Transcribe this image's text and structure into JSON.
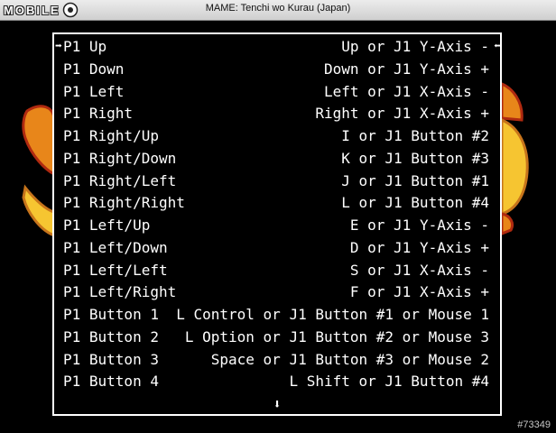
{
  "window": {
    "title": "MAME: Tenchi wo Kurau (Japan)"
  },
  "logo": {
    "text": "MOBILE",
    "icon": "eye-logo-icon"
  },
  "menu": {
    "rows": [
      {
        "name": "P1 Up",
        "value": "Up or J1 Y-Axis -"
      },
      {
        "name": "P1 Down",
        "value": "Down or J1 Y-Axis +"
      },
      {
        "name": "P1 Left",
        "value": "Left or J1 X-Axis -"
      },
      {
        "name": "P1 Right",
        "value": "Right or J1 X-Axis +"
      },
      {
        "name": "P1 Right/Up",
        "value": "I or J1 Button #2"
      },
      {
        "name": "P1 Right/Down",
        "value": "K or J1 Button #3"
      },
      {
        "name": "P1 Right/Left",
        "value": "J or J1 Button #1"
      },
      {
        "name": "P1 Right/Right",
        "value": "L or J1 Button #4"
      },
      {
        "name": "P1 Left/Up",
        "value": "E or J1 Y-Axis -"
      },
      {
        "name": "P1 Left/Down",
        "value": "D or J1 Y-Axis +"
      },
      {
        "name": "P1 Left/Left",
        "value": "S or J1 X-Axis -"
      },
      {
        "name": "P1 Left/Right",
        "value": "F or J1 X-Axis +"
      },
      {
        "name": "P1 Button 1",
        "value": "L Control or J1 Button #1 or Mouse 1"
      },
      {
        "name": "P1 Button 2",
        "value": "L Option or J1 Button #2 or Mouse 3"
      },
      {
        "name": "P1 Button 3",
        "value": "Space or J1 Button #3 or Mouse 2"
      },
      {
        "name": "P1 Button 4",
        "value": "L Shift or J1 Button #4"
      }
    ],
    "selected_index": 0,
    "selection_left_arrow": "➡",
    "selection_right_arrow": "⬅",
    "scroll_down_arrow": "⬇"
  },
  "colors": {
    "text": "#ffffff",
    "background": "#000000",
    "art_orange": "#e8861a",
    "art_yellow": "#f6c531",
    "art_red": "#b02a10"
  },
  "watermark": "#73349"
}
